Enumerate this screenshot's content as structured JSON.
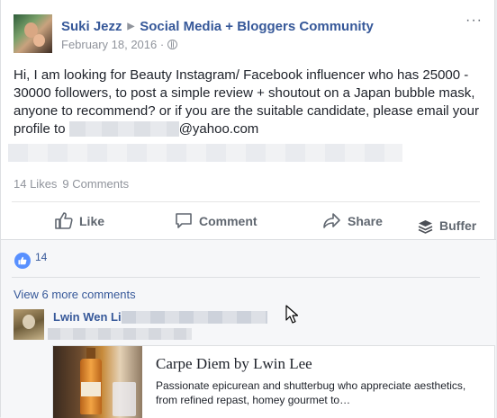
{
  "post": {
    "author": "Suki Jezz",
    "group": "Social Media + Bloggers Community",
    "date": "February 18, 2016",
    "separator": "·",
    "menu_icon": "···",
    "text_main": "Hi, I am looking for Beauty Instagram/ Facebook influencer who has 25000 - 30000 followers, to post a simple review + shoutout on a Japan bubble mask, anyone to recommend? or if you are the suitable candidate, please email your profile to ",
    "email_domain": "@yahoo.com",
    "likes": "14 Likes",
    "comments": "9 Comments"
  },
  "actions": {
    "like": "Like",
    "comment": "Comment",
    "share": "Share",
    "buffer": "Buffer"
  },
  "reactions": {
    "count": "14",
    "color": "#5890ff"
  },
  "comments_section": {
    "view_more": "View 6 more comments",
    "comment": {
      "author": "Lwin Wen Li",
      "link_card": {
        "title": "Carpe Diem by Lwin Lee",
        "description": "Passionate epicurean and shutterbug who appreciate aesthetics, from refined repast, homey gourmet to…"
      }
    }
  },
  "colors": {
    "link": "#365899",
    "muted": "#90949c",
    "action": "#606770"
  }
}
